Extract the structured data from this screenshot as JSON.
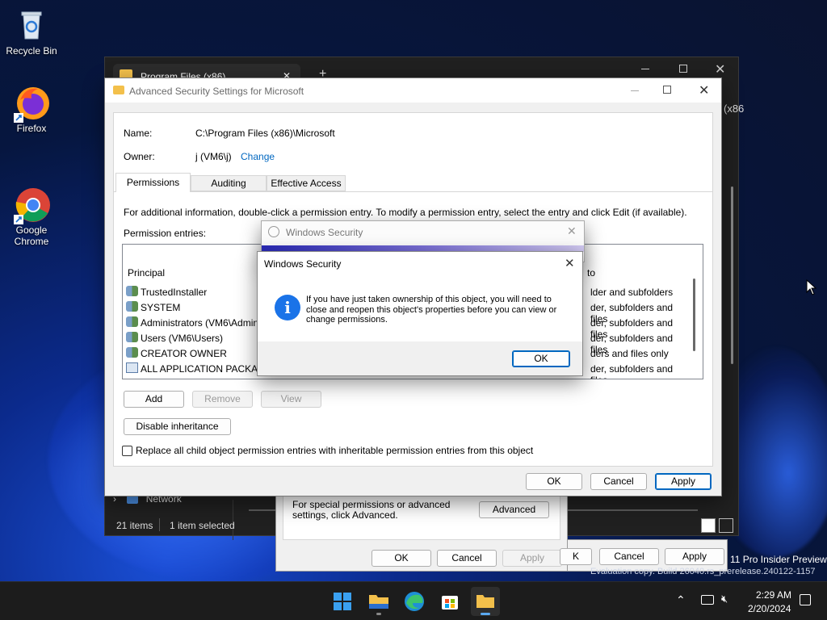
{
  "desktop": {
    "icons": [
      {
        "label": "Recycle Bin"
      },
      {
        "label": "Firefox"
      },
      {
        "label": "Google\nChrome"
      }
    ],
    "watermark_line1": "11 Pro Insider Preview",
    "watermark_line2": "Evaluation copy. Build 26040.rs_prerelease.240122-1157"
  },
  "explorer": {
    "tab_title": "Program Files (x86)",
    "tab_close": "✕",
    "new_tab": "+",
    "partial_right": "(x86",
    "nav_network": "Network",
    "status_items": "21 items",
    "status_selected": "1 item selected"
  },
  "properties_dialog": {
    "note": "For special permissions or advanced settings, click Advanced.",
    "advanced_label": "Advanced",
    "ok": "OK",
    "cancel": "Cancel",
    "apply": "Apply",
    "ok2_partial": "K",
    "cancel2": "Cancel",
    "apply2": "Apply"
  },
  "advanced": {
    "title": "Advanced Security Settings for Microsoft",
    "name_label": "Name:",
    "name_value": "C:\\Program Files (x86)\\Microsoft",
    "owner_label": "Owner:",
    "owner_value": "j (VM6\\j)",
    "change_link": "Change",
    "tabs": [
      {
        "label": "Permissions"
      },
      {
        "label": "Auditing"
      },
      {
        "label": "Effective Access"
      }
    ],
    "info_text": "For additional information, double-click a permission entry. To modify a permission entry, select the entry and click Edit (if available).",
    "entries_label": "Permission entries:",
    "col_principal": "Principal",
    "col_applies": "to",
    "rows": [
      {
        "principal": "TrustedInstaller",
        "applies": "lder and subfolders"
      },
      {
        "principal": "SYSTEM",
        "applies": "der, subfolders and files"
      },
      {
        "principal": "Administrators (VM6\\Admin",
        "applies": "der, subfolders and files"
      },
      {
        "principal": "Users (VM6\\Users)",
        "applies": "der, subfolders and files"
      },
      {
        "principal": "CREATOR OWNER",
        "applies": "ders and files only"
      },
      {
        "principal": "ALL APPLICATION PACKAG",
        "applies": "der, subfolders and files"
      }
    ],
    "add": "Add",
    "remove": "Remove",
    "view": "View",
    "disable_inheritance": "Disable inheritance",
    "replace_checkbox": "Replace all child object permission entries with inheritable permission entries from this object",
    "ok": "OK",
    "cancel": "Cancel",
    "apply": "Apply"
  },
  "security_progress": {
    "title": "Windows Security"
  },
  "message_box": {
    "title": "Windows Security",
    "message": "If you have just taken ownership of this object, you will need to close and reopen this object's properties before you can view or change permissions.",
    "ok": "OK"
  },
  "taskbar": {
    "time": "2:29 AM",
    "date": "2/20/2024"
  },
  "colors": {
    "accent": "#0067c0",
    "info_icon": "#1a73e8"
  }
}
